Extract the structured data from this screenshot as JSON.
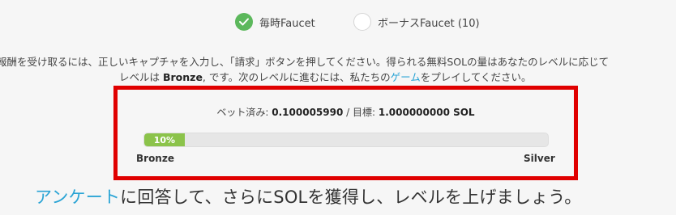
{
  "tabs": {
    "hourly": {
      "label": "毎時Faucet",
      "selected": true
    },
    "bonus": {
      "label": "ボーナスFaucet (10)",
      "selected": false
    }
  },
  "description": {
    "line1": "報酬を受け取るには、正しいキャプチャを入力し、「請求」ボタンを押してください。得られる無料SOLの量はあなたのレベルに応じて",
    "line2_prefix": "レベルは ",
    "level": "Bronze",
    "line2_middle": ", です。次のレベルに進むには、私たちの",
    "game_link": "ゲーム",
    "line2_suffix": "をプレイしてください。"
  },
  "progress": {
    "bet_label": "ベット済み: ",
    "bet_value": "0.100005990",
    "separator": " / ",
    "target_label": "目標: ",
    "target_value": "1.000000000 SOL",
    "percent_text": "10%",
    "percent": 10,
    "level_current": "Bronze",
    "level_next": "Silver"
  },
  "survey": {
    "link": "アンケート",
    "text": "に回答して、さらにSOLを獲得し、レベルを上げましょう。"
  },
  "colors": {
    "accent_green": "#5cb85c",
    "progress_green": "#8bc34a",
    "link_blue": "#2aa4d5",
    "highlight_red": "#e00000"
  }
}
